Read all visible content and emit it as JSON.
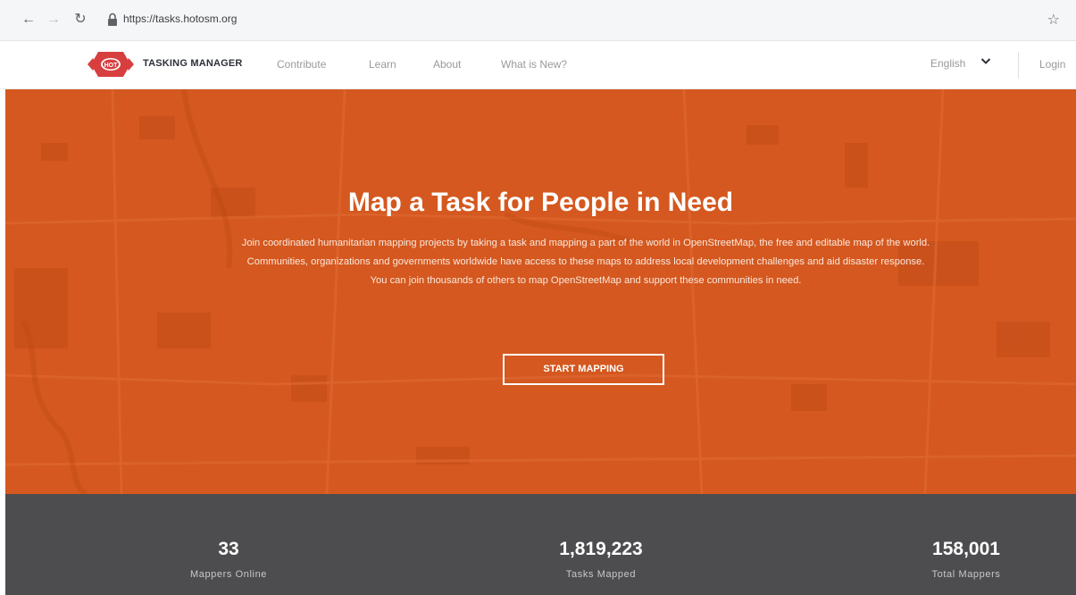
{
  "browser": {
    "url": "https://tasks.hotosm.org",
    "back_icon": "arrow-left-icon",
    "forward_icon": "arrow-right-icon",
    "reload_icon": "reload-icon",
    "lock_icon": "lock-icon",
    "star_icon": "star-icon"
  },
  "header": {
    "logo_text": "HOT",
    "brand": "TASKING MANAGER",
    "nav": {
      "contribute": "Contribute",
      "learn": "Learn",
      "about": "About",
      "whats_new": "What is New?"
    },
    "language": "English",
    "login": "Login"
  },
  "hero": {
    "title": "Map a Task for People in Need",
    "description": "Join coordinated humanitarian mapping projects by taking a task and mapping a part of the world in OpenStreetMap, the free and editable map of the world. Communities, organizations and governments worldwide have access to these maps to address local development challenges and aid disaster response. You can join thousands of others to map OpenStreetMap and support these communities in need.",
    "cta": "START MAPPING"
  },
  "stats": [
    {
      "value": "33",
      "label": "Mappers Online"
    },
    {
      "value": "1,819,223",
      "label": "Tasks Mapped"
    },
    {
      "value": "158,001",
      "label": "Total Mappers"
    }
  ],
  "colors": {
    "accent": "#d4581f",
    "stats_bg": "#4d4d4f",
    "logo_red": "#d73f3f"
  }
}
